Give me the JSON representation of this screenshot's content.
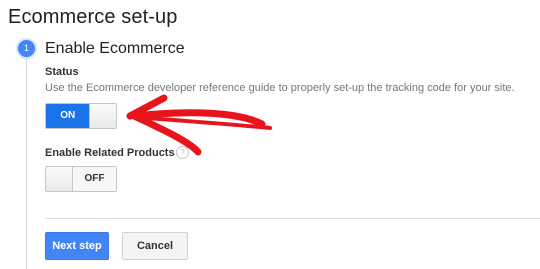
{
  "page": {
    "title": "Ecommerce set-up"
  },
  "step": {
    "number": "1",
    "title": "Enable Ecommerce"
  },
  "status": {
    "label": "Status",
    "hint": "Use the Ecommerce developer reference guide to properly set-up the tracking code for your site.",
    "toggle_label": "ON",
    "value": "on"
  },
  "related_products": {
    "label": "Enable Related Products",
    "help_glyph": "?",
    "toggle_label": "OFF",
    "value": "off"
  },
  "actions": {
    "next_label": "Next step",
    "cancel_label": "Cancel"
  },
  "colors": {
    "accent": "#4285f4",
    "toggle_on": "#1a73e8",
    "annotation_arrow": "#e8141c"
  },
  "icons": [
    "help-icon",
    "annotation-arrow"
  ]
}
